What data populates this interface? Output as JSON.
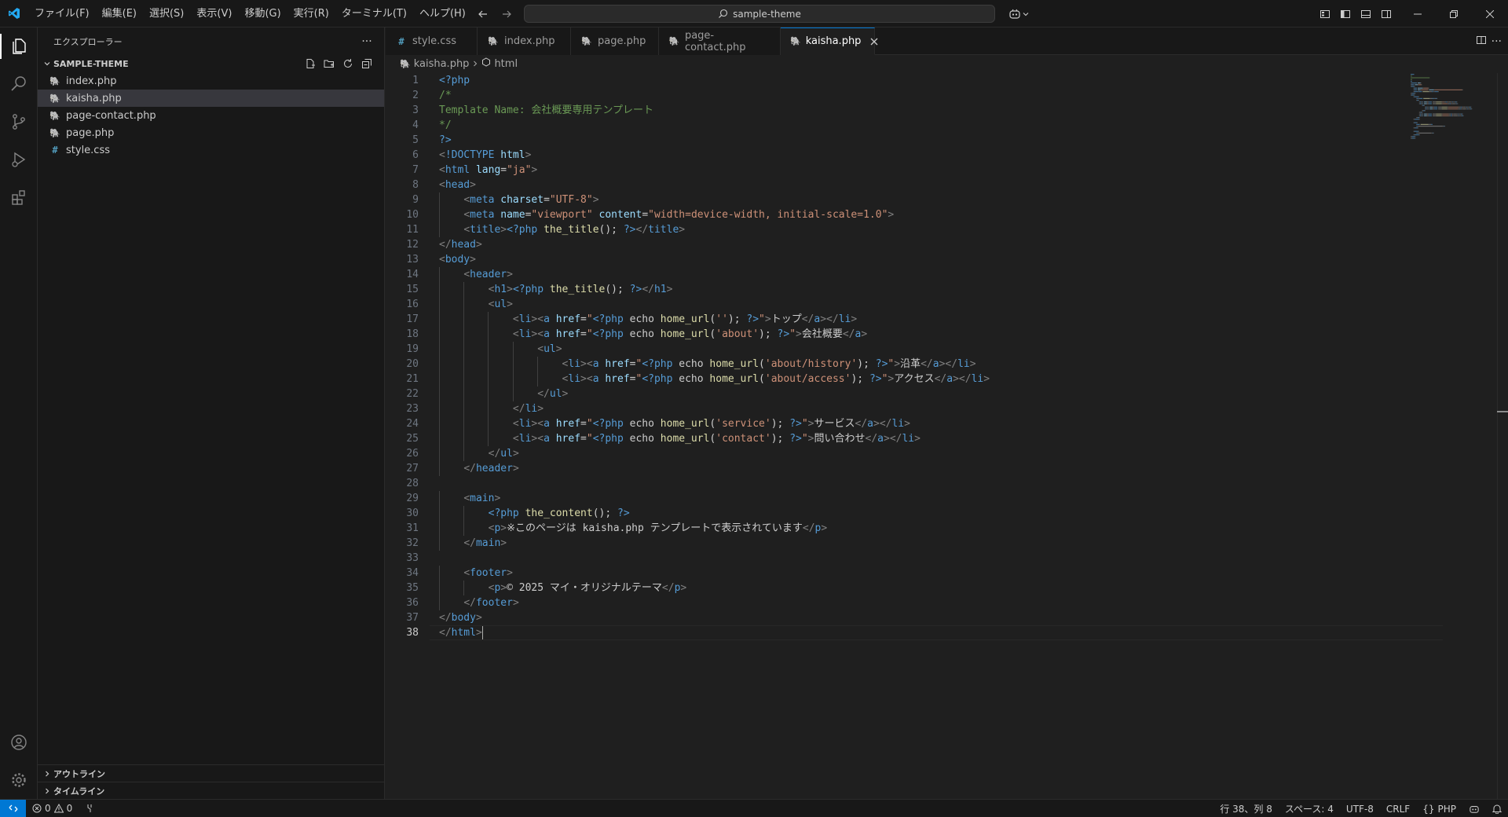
{
  "menu": [
    "ファイル(F)",
    "編集(E)",
    "選択(S)",
    "表示(V)",
    "移動(G)",
    "実行(R)",
    "ターミナル(T)",
    "ヘルプ(H)"
  ],
  "search": {
    "label": "sample-theme"
  },
  "sidebar": {
    "title": "エクスプローラー",
    "folder": "SAMPLE-THEME",
    "files": [
      {
        "name": "index.php",
        "type": "php"
      },
      {
        "name": "kaisha.php",
        "type": "php"
      },
      {
        "name": "page-contact.php",
        "type": "php"
      },
      {
        "name": "page.php",
        "type": "php"
      },
      {
        "name": "style.css",
        "type": "css"
      }
    ],
    "outline_label": "アウトライン",
    "timeline_label": "タイムライン"
  },
  "tabs": [
    {
      "label": "style.css",
      "type": "css"
    },
    {
      "label": "index.php",
      "type": "php"
    },
    {
      "label": "page.php",
      "type": "php"
    },
    {
      "label": "page-contact.php",
      "type": "php"
    },
    {
      "label": "kaisha.php",
      "type": "php"
    }
  ],
  "breadcrumb": {
    "file": "kaisha.php",
    "symbol": "html"
  },
  "code_lines": [
    [
      [
        "php",
        "<?php"
      ]
    ],
    [
      [
        "cmt",
        "/*"
      ]
    ],
    [
      [
        "cmt",
        "Template Name: 会社概要専用テンプレート"
      ]
    ],
    [
      [
        "cmt",
        "*/"
      ]
    ],
    [
      [
        "php",
        "?>"
      ]
    ],
    [
      [
        "pun",
        "<"
      ],
      [
        "tag",
        "!DOCTYPE"
      ],
      [
        "txt",
        " "
      ],
      [
        "attr",
        "html"
      ],
      [
        "pun",
        ">"
      ]
    ],
    [
      [
        "pun",
        "<"
      ],
      [
        "tag",
        "html"
      ],
      [
        "txt",
        " "
      ],
      [
        "attr",
        "lang"
      ],
      [
        "txt",
        "="
      ],
      [
        "str",
        "\"ja\""
      ],
      [
        "pun",
        ">"
      ]
    ],
    [
      [
        "pun",
        "<"
      ],
      [
        "tag",
        "head"
      ],
      [
        "pun",
        ">"
      ]
    ],
    [
      [
        "txt",
        "    "
      ],
      [
        "pun",
        "<"
      ],
      [
        "tag",
        "meta"
      ],
      [
        "txt",
        " "
      ],
      [
        "attr",
        "charset"
      ],
      [
        "txt",
        "="
      ],
      [
        "str",
        "\"UTF-8\""
      ],
      [
        "pun",
        ">"
      ]
    ],
    [
      [
        "txt",
        "    "
      ],
      [
        "pun",
        "<"
      ],
      [
        "tag",
        "meta"
      ],
      [
        "txt",
        " "
      ],
      [
        "attr",
        "name"
      ],
      [
        "txt",
        "="
      ],
      [
        "str",
        "\"viewport\""
      ],
      [
        "txt",
        " "
      ],
      [
        "attr",
        "content"
      ],
      [
        "txt",
        "="
      ],
      [
        "str",
        "\"width=device-width, initial-scale=1.0\""
      ],
      [
        "pun",
        ">"
      ]
    ],
    [
      [
        "txt",
        "    "
      ],
      [
        "pun",
        "<"
      ],
      [
        "tag",
        "title"
      ],
      [
        "pun",
        ">"
      ],
      [
        "php",
        "<?php"
      ],
      [
        "txt",
        " "
      ],
      [
        "fn",
        "the_title"
      ],
      [
        "txt",
        "(); "
      ],
      [
        "php",
        "?>"
      ],
      [
        "pun",
        "</"
      ],
      [
        "tag",
        "title"
      ],
      [
        "pun",
        ">"
      ]
    ],
    [
      [
        "pun",
        "</"
      ],
      [
        "tag",
        "head"
      ],
      [
        "pun",
        ">"
      ]
    ],
    [
      [
        "pun",
        "<"
      ],
      [
        "tag",
        "body"
      ],
      [
        "pun",
        ">"
      ]
    ],
    [
      [
        "txt",
        "    "
      ],
      [
        "pun",
        "<"
      ],
      [
        "tag",
        "header"
      ],
      [
        "pun",
        ">"
      ]
    ],
    [
      [
        "txt",
        "        "
      ],
      [
        "pun",
        "<"
      ],
      [
        "tag",
        "h1"
      ],
      [
        "pun",
        ">"
      ],
      [
        "php",
        "<?php"
      ],
      [
        "txt",
        " "
      ],
      [
        "fn",
        "the_title"
      ],
      [
        "txt",
        "(); "
      ],
      [
        "php",
        "?>"
      ],
      [
        "pun",
        "</"
      ],
      [
        "tag",
        "h1"
      ],
      [
        "pun",
        ">"
      ]
    ],
    [
      [
        "txt",
        "        "
      ],
      [
        "pun",
        "<"
      ],
      [
        "tag",
        "ul"
      ],
      [
        "pun",
        ">"
      ]
    ],
    [
      [
        "txt",
        "            "
      ],
      [
        "pun",
        "<"
      ],
      [
        "tag",
        "li"
      ],
      [
        "pun",
        "><"
      ],
      [
        "tag",
        "a"
      ],
      [
        "txt",
        " "
      ],
      [
        "attr",
        "href"
      ],
      [
        "txt",
        "="
      ],
      [
        "str",
        "\""
      ],
      [
        "php",
        "<?php"
      ],
      [
        "txt",
        " echo "
      ],
      [
        "fn",
        "home_url"
      ],
      [
        "txt",
        "("
      ],
      [
        "str",
        "''"
      ],
      [
        "txt",
        "); "
      ],
      [
        "php",
        "?>"
      ],
      [
        "str",
        "\""
      ],
      [
        "pun",
        ">"
      ],
      [
        "txt",
        "トップ"
      ],
      [
        "pun",
        "</"
      ],
      [
        "tag",
        "a"
      ],
      [
        "pun",
        "></"
      ],
      [
        "tag",
        "li"
      ],
      [
        "pun",
        ">"
      ]
    ],
    [
      [
        "txt",
        "            "
      ],
      [
        "pun",
        "<"
      ],
      [
        "tag",
        "li"
      ],
      [
        "pun",
        "><"
      ],
      [
        "tag",
        "a"
      ],
      [
        "txt",
        " "
      ],
      [
        "attr",
        "href"
      ],
      [
        "txt",
        "="
      ],
      [
        "str",
        "\""
      ],
      [
        "php",
        "<?php"
      ],
      [
        "txt",
        " echo "
      ],
      [
        "fn",
        "home_url"
      ],
      [
        "txt",
        "("
      ],
      [
        "str",
        "'about'"
      ],
      [
        "txt",
        "); "
      ],
      [
        "php",
        "?>"
      ],
      [
        "str",
        "\""
      ],
      [
        "pun",
        ">"
      ],
      [
        "txt",
        "会社概要"
      ],
      [
        "pun",
        "</"
      ],
      [
        "tag",
        "a"
      ],
      [
        "pun",
        ">"
      ]
    ],
    [
      [
        "txt",
        "                "
      ],
      [
        "pun",
        "<"
      ],
      [
        "tag",
        "ul"
      ],
      [
        "pun",
        ">"
      ]
    ],
    [
      [
        "txt",
        "                    "
      ],
      [
        "pun",
        "<"
      ],
      [
        "tag",
        "li"
      ],
      [
        "pun",
        "><"
      ],
      [
        "tag",
        "a"
      ],
      [
        "txt",
        " "
      ],
      [
        "attr",
        "href"
      ],
      [
        "txt",
        "="
      ],
      [
        "str",
        "\""
      ],
      [
        "php",
        "<?php"
      ],
      [
        "txt",
        " echo "
      ],
      [
        "fn",
        "home_url"
      ],
      [
        "txt",
        "("
      ],
      [
        "str",
        "'about/history'"
      ],
      [
        "txt",
        "); "
      ],
      [
        "php",
        "?>"
      ],
      [
        "str",
        "\""
      ],
      [
        "pun",
        ">"
      ],
      [
        "txt",
        "沿革"
      ],
      [
        "pun",
        "</"
      ],
      [
        "tag",
        "a"
      ],
      [
        "pun",
        "></"
      ],
      [
        "tag",
        "li"
      ],
      [
        "pun",
        ">"
      ]
    ],
    [
      [
        "txt",
        "                    "
      ],
      [
        "pun",
        "<"
      ],
      [
        "tag",
        "li"
      ],
      [
        "pun",
        "><"
      ],
      [
        "tag",
        "a"
      ],
      [
        "txt",
        " "
      ],
      [
        "attr",
        "href"
      ],
      [
        "txt",
        "="
      ],
      [
        "str",
        "\""
      ],
      [
        "php",
        "<?php"
      ],
      [
        "txt",
        " echo "
      ],
      [
        "fn",
        "home_url"
      ],
      [
        "txt",
        "("
      ],
      [
        "str",
        "'about/access'"
      ],
      [
        "txt",
        "); "
      ],
      [
        "php",
        "?>"
      ],
      [
        "str",
        "\""
      ],
      [
        "pun",
        ">"
      ],
      [
        "txt",
        "アクセス"
      ],
      [
        "pun",
        "</"
      ],
      [
        "tag",
        "a"
      ],
      [
        "pun",
        "></"
      ],
      [
        "tag",
        "li"
      ],
      [
        "pun",
        ">"
      ]
    ],
    [
      [
        "txt",
        "                "
      ],
      [
        "pun",
        "</"
      ],
      [
        "tag",
        "ul"
      ],
      [
        "pun",
        ">"
      ]
    ],
    [
      [
        "txt",
        "            "
      ],
      [
        "pun",
        "</"
      ],
      [
        "tag",
        "li"
      ],
      [
        "pun",
        ">"
      ]
    ],
    [
      [
        "txt",
        "            "
      ],
      [
        "pun",
        "<"
      ],
      [
        "tag",
        "li"
      ],
      [
        "pun",
        "><"
      ],
      [
        "tag",
        "a"
      ],
      [
        "txt",
        " "
      ],
      [
        "attr",
        "href"
      ],
      [
        "txt",
        "="
      ],
      [
        "str",
        "\""
      ],
      [
        "php",
        "<?php"
      ],
      [
        "txt",
        " echo "
      ],
      [
        "fn",
        "home_url"
      ],
      [
        "txt",
        "("
      ],
      [
        "str",
        "'service'"
      ],
      [
        "txt",
        "); "
      ],
      [
        "php",
        "?>"
      ],
      [
        "str",
        "\""
      ],
      [
        "pun",
        ">"
      ],
      [
        "txt",
        "サービス"
      ],
      [
        "pun",
        "</"
      ],
      [
        "tag",
        "a"
      ],
      [
        "pun",
        "></"
      ],
      [
        "tag",
        "li"
      ],
      [
        "pun",
        ">"
      ]
    ],
    [
      [
        "txt",
        "            "
      ],
      [
        "pun",
        "<"
      ],
      [
        "tag",
        "li"
      ],
      [
        "pun",
        "><"
      ],
      [
        "tag",
        "a"
      ],
      [
        "txt",
        " "
      ],
      [
        "attr",
        "href"
      ],
      [
        "txt",
        "="
      ],
      [
        "str",
        "\""
      ],
      [
        "php",
        "<?php"
      ],
      [
        "txt",
        " echo "
      ],
      [
        "fn",
        "home_url"
      ],
      [
        "txt",
        "("
      ],
      [
        "str",
        "'contact'"
      ],
      [
        "txt",
        "); "
      ],
      [
        "php",
        "?>"
      ],
      [
        "str",
        "\""
      ],
      [
        "pun",
        ">"
      ],
      [
        "txt",
        "問い合わせ"
      ],
      [
        "pun",
        "</"
      ],
      [
        "tag",
        "a"
      ],
      [
        "pun",
        "></"
      ],
      [
        "tag",
        "li"
      ],
      [
        "pun",
        ">"
      ]
    ],
    [
      [
        "txt",
        "        "
      ],
      [
        "pun",
        "</"
      ],
      [
        "tag",
        "ul"
      ],
      [
        "pun",
        ">"
      ]
    ],
    [
      [
        "txt",
        "    "
      ],
      [
        "pun",
        "</"
      ],
      [
        "tag",
        "header"
      ],
      [
        "pun",
        ">"
      ]
    ],
    [
      [
        "txt",
        ""
      ]
    ],
    [
      [
        "txt",
        "    "
      ],
      [
        "pun",
        "<"
      ],
      [
        "tag",
        "main"
      ],
      [
        "pun",
        ">"
      ]
    ],
    [
      [
        "txt",
        "        "
      ],
      [
        "php",
        "<?php"
      ],
      [
        "txt",
        " "
      ],
      [
        "fn",
        "the_content"
      ],
      [
        "txt",
        "(); "
      ],
      [
        "php",
        "?>"
      ]
    ],
    [
      [
        "txt",
        "        "
      ],
      [
        "pun",
        "<"
      ],
      [
        "tag",
        "p"
      ],
      [
        "pun",
        ">"
      ],
      [
        "txt",
        "※このページは kaisha.php テンプレートで表示されています"
      ],
      [
        "pun",
        "</"
      ],
      [
        "tag",
        "p"
      ],
      [
        "pun",
        ">"
      ]
    ],
    [
      [
        "txt",
        "    "
      ],
      [
        "pun",
        "</"
      ],
      [
        "tag",
        "main"
      ],
      [
        "pun",
        ">"
      ]
    ],
    [
      [
        "txt",
        ""
      ]
    ],
    [
      [
        "txt",
        "    "
      ],
      [
        "pun",
        "<"
      ],
      [
        "tag",
        "footer"
      ],
      [
        "pun",
        ">"
      ]
    ],
    [
      [
        "txt",
        "        "
      ],
      [
        "pun",
        "<"
      ],
      [
        "tag",
        "p"
      ],
      [
        "pun",
        ">"
      ],
      [
        "txt",
        "© 2025 マイ・オリジナルテーマ"
      ],
      [
        "pun",
        "</"
      ],
      [
        "tag",
        "p"
      ],
      [
        "pun",
        ">"
      ]
    ],
    [
      [
        "txt",
        "    "
      ],
      [
        "pun",
        "</"
      ],
      [
        "tag",
        "footer"
      ],
      [
        "pun",
        ">"
      ]
    ],
    [
      [
        "pun",
        "</"
      ],
      [
        "tag",
        "body"
      ],
      [
        "pun",
        ">"
      ]
    ],
    [
      [
        "pun",
        "</"
      ],
      [
        "tag",
        "html"
      ],
      [
        "pun",
        ">"
      ]
    ]
  ],
  "status": {
    "errors": "0",
    "warnings": "0",
    "position": "行 38、列 8",
    "spaces": "スペース: 4",
    "encoding": "UTF-8",
    "eol": "CRLF",
    "language": "PHP"
  },
  "colors": {
    "accent": "#0078d4",
    "php_icon": "#a074c4",
    "css_icon": "#519aba"
  }
}
